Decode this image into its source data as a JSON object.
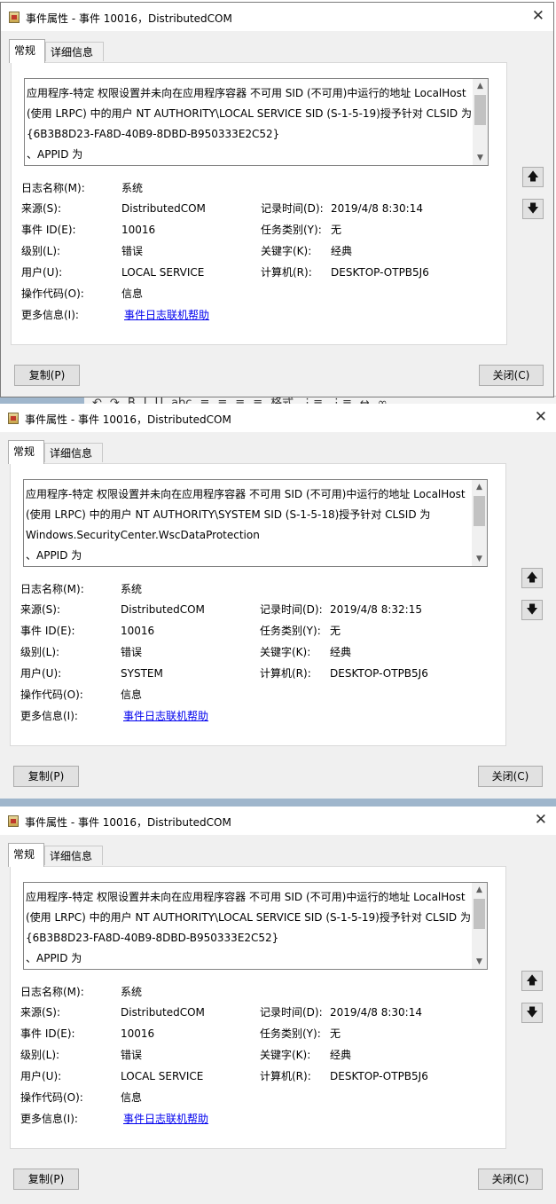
{
  "dialogs": [
    {
      "title": "事件属性 - 事件 10016，DistributedCOM",
      "tabs": [
        "常规",
        "详细信息"
      ],
      "description": [
        "应用程序-特定 权限设置并未向在应用程序容器 不可用 SID (不可用)中运行的地址 LocalHost",
        "(使用 LRPC) 中的用户 NT AUTHORITY\\LOCAL SERVICE SID (S-1-5-19)授予针对 CLSID 为",
        "{6B3B8D23-FA8D-40B9-8DBD-B950333E2C52}",
        "、APPID 为"
      ],
      "labels": {
        "log_name": "日志名称(M):",
        "source": "来源(S):",
        "event_id": "事件 ID(E):",
        "level": "级别(L):",
        "user": "用户(U):",
        "opcode": "操作代码(O):",
        "more_info": "更多信息(I):",
        "logged": "记录时间(D):",
        "task_category": "任务类别(Y):",
        "keywords": "关键字(K):",
        "computer": "计算机(R):"
      },
      "values": {
        "log_name": "系统",
        "source": "DistributedCOM",
        "event_id": "10016",
        "level": "错误",
        "user": "LOCAL SERVICE",
        "opcode": "信息",
        "more_info": "事件日志联机帮助",
        "logged": "2019/4/8 8:30:14",
        "task_category": "无",
        "keywords": "经典",
        "computer": "DESKTOP-OTPB5J6"
      },
      "buttons": {
        "copy": "复制(P)",
        "close": "关闭(C)"
      }
    },
    {
      "title": "事件属性 - 事件 10016，DistributedCOM",
      "tabs": [
        "常规",
        "详细信息"
      ],
      "description": [
        "应用程序-特定 权限设置并未向在应用程序容器 不可用 SID (不可用)中运行的地址 LocalHost",
        "(使用 LRPC) 中的用户 NT AUTHORITY\\SYSTEM SID (S-1-5-18)授予针对 CLSID 为",
        "Windows.SecurityCenter.WscDataProtection",
        "、APPID 为"
      ],
      "labels": {
        "log_name": "日志名称(M):",
        "source": "来源(S):",
        "event_id": "事件 ID(E):",
        "level": "级别(L):",
        "user": "用户(U):",
        "opcode": "操作代码(O):",
        "more_info": "更多信息(I):",
        "logged": "记录时间(D):",
        "task_category": "任务类别(Y):",
        "keywords": "关键字(K):",
        "computer": "计算机(R):"
      },
      "values": {
        "log_name": "系统",
        "source": "DistributedCOM",
        "event_id": "10016",
        "level": "错误",
        "user": "SYSTEM",
        "opcode": "信息",
        "more_info": "事件日志联机帮助",
        "logged": "2019/4/8 8:32:15",
        "task_category": "无",
        "keywords": "经典",
        "computer": "DESKTOP-OTPB5J6"
      },
      "buttons": {
        "copy": "复制(P)",
        "close": "关闭(C)"
      }
    },
    {
      "title": "事件属性 - 事件 10016，DistributedCOM",
      "tabs": [
        "常规",
        "详细信息"
      ],
      "description": [
        "应用程序-特定 权限设置并未向在应用程序容器 不可用 SID (不可用)中运行的地址 LocalHost",
        "(使用 LRPC) 中的用户 NT AUTHORITY\\LOCAL SERVICE SID (S-1-5-19)授予针对 CLSID 为",
        "{6B3B8D23-FA8D-40B9-8DBD-B950333E2C52}",
        "、APPID 为"
      ],
      "labels": {
        "log_name": "日志名称(M):",
        "source": "来源(S):",
        "event_id": "事件 ID(E):",
        "level": "级别(L):",
        "user": "用户(U):",
        "opcode": "操作代码(O):",
        "more_info": "更多信息(I):",
        "logged": "记录时间(D):",
        "task_category": "任务类别(Y):",
        "keywords": "关键字(K):",
        "computer": "计算机(R):"
      },
      "values": {
        "log_name": "系统",
        "source": "DistributedCOM",
        "event_id": "10016",
        "level": "错误",
        "user": "LOCAL SERVICE",
        "opcode": "信息",
        "more_info": "事件日志联机帮助",
        "logged": "2019/4/8 8:30:14",
        "task_category": "无",
        "keywords": "经典",
        "computer": "DESKTOP-OTPB5J6"
      },
      "buttons": {
        "copy": "复制(P)",
        "close": "关闭(C)"
      }
    }
  ],
  "background_toolbar": {
    "glyphs": [
      "↶",
      "↷",
      "B",
      "I",
      "U",
      "abc",
      "≡",
      "≡",
      "≡",
      "≡",
      "格式",
      "⋮≡",
      "⋮≡",
      "↔",
      "∞"
    ]
  },
  "icons": {
    "app": "event-viewer-icon",
    "close": "close-icon",
    "up": "arrow-up-icon",
    "down": "arrow-down-icon"
  }
}
